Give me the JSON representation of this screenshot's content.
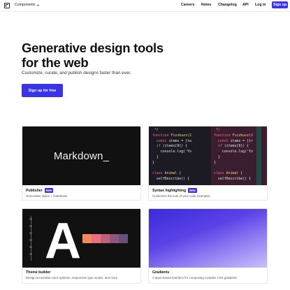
{
  "nav": {
    "components_label": "Components",
    "links": [
      "Careers",
      "Notes",
      "Changelog",
      "API",
      "Log in"
    ],
    "signup_label": "Sign up"
  },
  "hero": {
    "title_line1": "Generative design tools",
    "title_line2": "for the web",
    "subtitle": "Customize, curate, and publish designs faster than ever.",
    "cta_label": "Sign up for free"
  },
  "cards": [
    {
      "title": "Publisher",
      "badge": "New",
      "description": "Generative styles + markdown",
      "thumb_text": "Markdown_"
    },
    {
      "title": "Syntax highlighting",
      "badge": "New",
      "description": "Customize the look of your code examples"
    },
    {
      "title": "Theme builder",
      "badge": "",
      "description": "Design accessible color systems, responsive type scales, and more",
      "thumb_text": "A"
    },
    {
      "title": "Gradients",
      "badge": "",
      "description": "A layer-based interface for composing complex CSS gradients"
    }
  ],
  "code": {
    "col_a": [
      " */",
      "function Fizzbuzz(2",
      "  const items = [ta",
      "  if (items[0]) {",
      "    console.log('Yo",
      "  }",
      "}",
      "",
      "class Animal {",
      "  selfDescribe() {"
    ],
    "col_b": [
      " */",
      "function Fizzbuzz(2",
      "  const items = [tr",
      "  if (items[0]) {",
      "    console.log('Yo",
      "  }",
      "}",
      "",
      "class Animal {",
      "  selfDescribe() {"
    ]
  },
  "colors": {
    "accent": "#3b33e8",
    "swatches": [
      "#f08a5d",
      "#e8707a",
      "#c2607a",
      "#8c5778",
      "#6a4f7a"
    ]
  }
}
